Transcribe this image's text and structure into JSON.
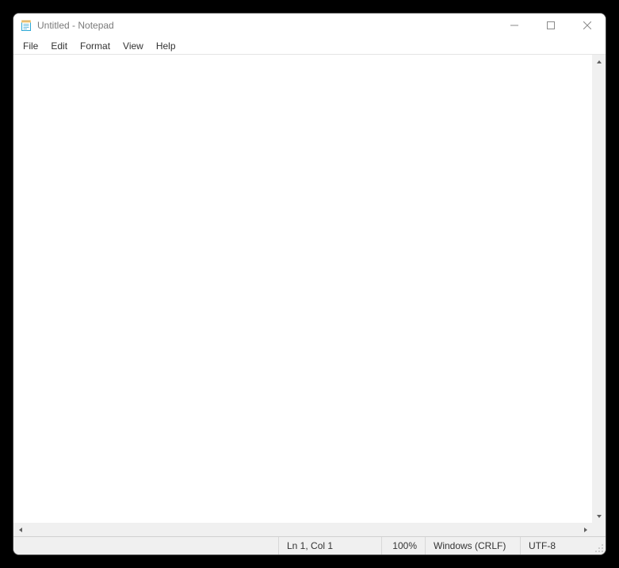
{
  "titlebar": {
    "title": "Untitled - Notepad"
  },
  "menu": {
    "file": "File",
    "edit": "Edit",
    "format": "Format",
    "view": "View",
    "help": "Help"
  },
  "editor": {
    "content": ""
  },
  "status": {
    "position": "Ln 1, Col 1",
    "zoom": "100%",
    "eol": "Windows (CRLF)",
    "encoding": "UTF-8"
  }
}
